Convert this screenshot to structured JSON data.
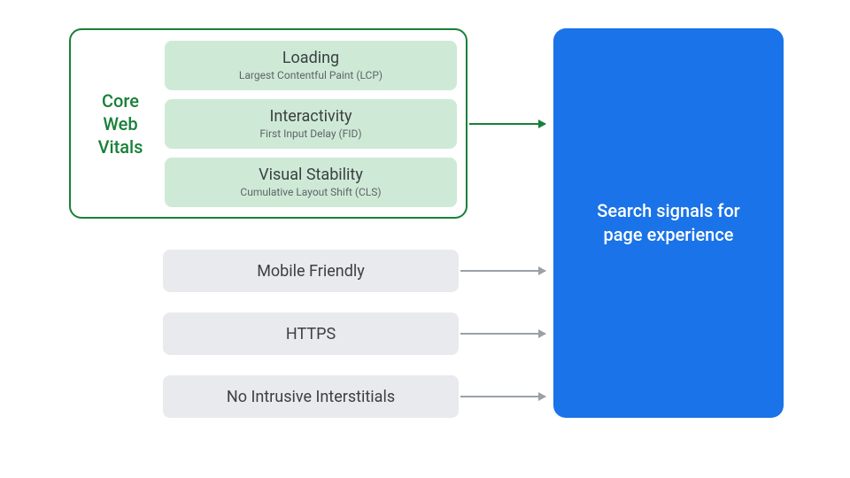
{
  "cwv": {
    "label": "Core\nWeb\nVitals",
    "metrics": [
      {
        "title": "Loading",
        "sub": "Largest Contentful Paint (LCP)"
      },
      {
        "title": "Interactivity",
        "sub": "First Input Delay (FID)"
      },
      {
        "title": "Visual Stability",
        "sub": "Cumulative Layout Shift (CLS)"
      }
    ]
  },
  "signals": [
    "Mobile Friendly",
    "HTTPS",
    "No Intrusive Interstitials"
  ],
  "result": "Search signals for page experience",
  "colors": {
    "green": "#188038",
    "mint": "#ceead6",
    "gray": "#e8eaed",
    "blue": "#1a73e8",
    "arrowGray": "#9aa0a6"
  }
}
